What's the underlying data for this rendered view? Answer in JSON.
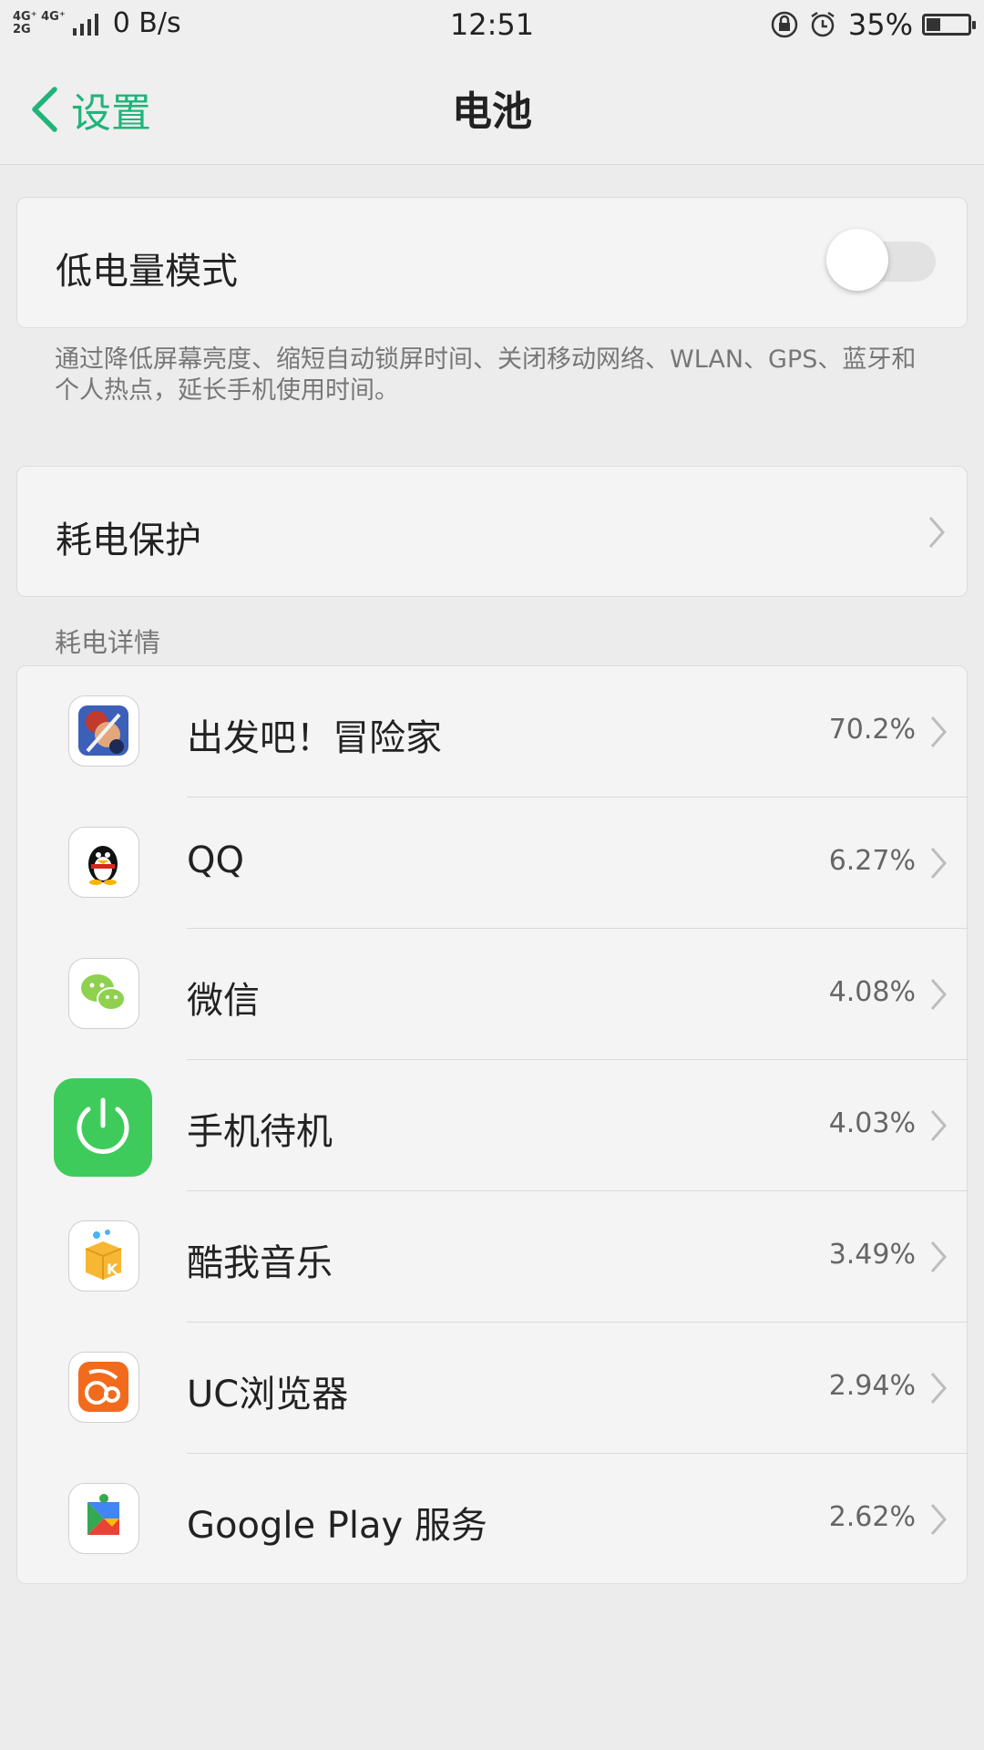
{
  "status_bar": {
    "network_top": "4G⁺ 4G⁺",
    "network_bottom": "2G",
    "speed": "0 B/s",
    "time": "12:51",
    "battery_percent": "35%",
    "battery_level": 0.35
  },
  "nav": {
    "back_label": "设置",
    "title": "电池"
  },
  "low_power": {
    "label": "低电量模式",
    "enabled": false,
    "description": "通过降低屏幕亮度、缩短自动锁屏时间、关闭移动网络、WLAN、GPS、蓝牙和个人热点，延长手机使用时间。"
  },
  "protection": {
    "label": "耗电保护"
  },
  "details": {
    "header": "耗电详情",
    "apps": [
      {
        "name": "出发吧！冒险家",
        "percent": "70.2%",
        "icon": "adventure-game-icon"
      },
      {
        "name": "QQ",
        "percent": "6.27%",
        "icon": "qq-penguin-icon"
      },
      {
        "name": "微信",
        "percent": "4.08%",
        "icon": "wechat-icon"
      },
      {
        "name": "手机待机",
        "percent": "4.03%",
        "icon": "power-standby-icon"
      },
      {
        "name": "酷我音乐",
        "percent": "3.49%",
        "icon": "kuwo-music-icon"
      },
      {
        "name": "UC浏览器",
        "percent": "2.94%",
        "icon": "uc-browser-icon"
      },
      {
        "name": "Google Play 服务",
        "percent": "2.62%",
        "icon": "google-play-services-icon"
      }
    ]
  },
  "colors": {
    "accent": "#20b47a",
    "standby_green": "#3ecb5c"
  }
}
